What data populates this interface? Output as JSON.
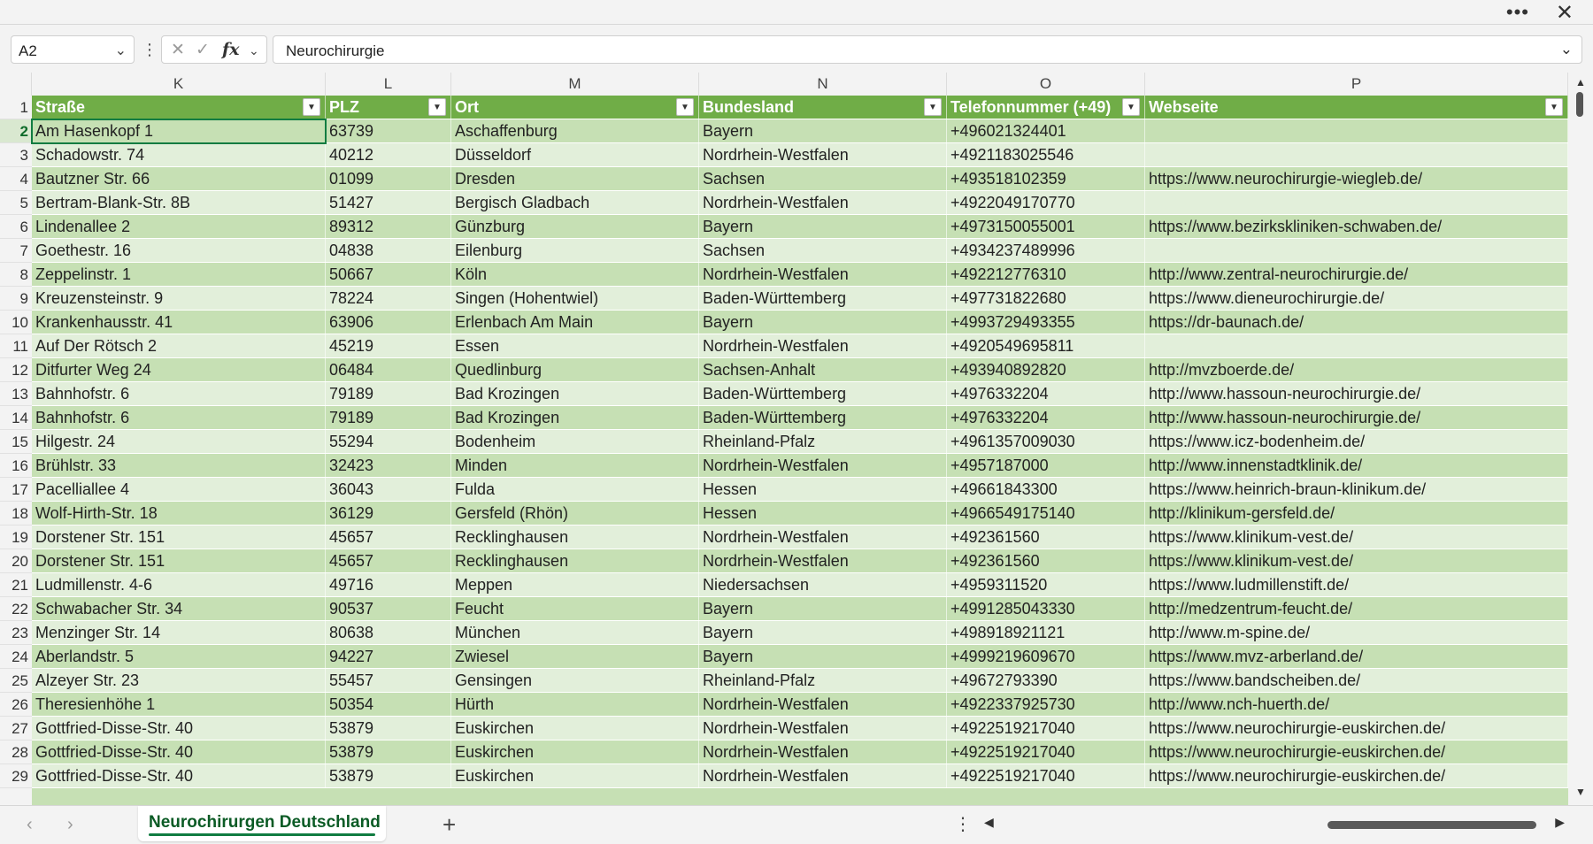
{
  "window": {
    "more_icon": "more-icon",
    "close_icon": "close-icon"
  },
  "formula_bar": {
    "name_box": "A2",
    "fx_label": "fx",
    "content": "Neurochirurgie"
  },
  "columns": [
    {
      "letter": "K",
      "header": "Straße"
    },
    {
      "letter": "L",
      "header": "PLZ"
    },
    {
      "letter": "M",
      "header": "Ort"
    },
    {
      "letter": "N",
      "header": "Bundesland"
    },
    {
      "letter": "O",
      "header": "Telefonnummer (+49)"
    },
    {
      "letter": "P",
      "header": "Webseite"
    }
  ],
  "header_row_number": "1",
  "rows": [
    {
      "n": "2",
      "cells": [
        "Am Hasenkopf 1",
        "63739",
        "Aschaffenburg",
        "Bayern",
        "+496021324401",
        ""
      ]
    },
    {
      "n": "3",
      "cells": [
        "Schadowstr. 74",
        "40212",
        "Düsseldorf",
        "Nordrhein-Westfalen",
        "+4921183025546",
        ""
      ]
    },
    {
      "n": "4",
      "cells": [
        "Bautzner Str. 66",
        "01099",
        "Dresden",
        "Sachsen",
        "+493518102359",
        "https://www.neurochirurgie-wiegleb.de/"
      ]
    },
    {
      "n": "5",
      "cells": [
        "Bertram-Blank-Str. 8B",
        "51427",
        "Bergisch Gladbach",
        "Nordrhein-Westfalen",
        "+4922049170770",
        ""
      ]
    },
    {
      "n": "6",
      "cells": [
        "Lindenallee 2",
        "89312",
        "Günzburg",
        "Bayern",
        "+4973150055001",
        "https://www.bezirkskliniken-schwaben.de/"
      ]
    },
    {
      "n": "7",
      "cells": [
        "Goethestr. 16",
        "04838",
        "Eilenburg",
        "Sachsen",
        "+4934237489996",
        ""
      ]
    },
    {
      "n": "8",
      "cells": [
        "Zeppelinstr. 1",
        "50667",
        "Köln",
        "Nordrhein-Westfalen",
        "+492212776310",
        "http://www.zentral-neurochirurgie.de/"
      ]
    },
    {
      "n": "9",
      "cells": [
        "Kreuzensteinstr. 9",
        "78224",
        "Singen (Hohentwiel)",
        "Baden-Württemberg",
        "+497731822680",
        "https://www.dieneurochirurgie.de/"
      ]
    },
    {
      "n": "10",
      "cells": [
        "Krankenhausstr. 41",
        "63906",
        "Erlenbach Am Main",
        "Bayern",
        "+4993729493355",
        "https://dr-baunach.de/"
      ]
    },
    {
      "n": "11",
      "cells": [
        "Auf Der Rötsch 2",
        "45219",
        "Essen",
        "Nordrhein-Westfalen",
        "+4920549695811",
        ""
      ]
    },
    {
      "n": "12",
      "cells": [
        "Ditfurter Weg 24",
        "06484",
        "Quedlinburg",
        "Sachsen-Anhalt",
        "+493940892820",
        "http://mvzboerde.de/"
      ]
    },
    {
      "n": "13",
      "cells": [
        "Bahnhofstr. 6",
        "79189",
        "Bad Krozingen",
        "Baden-Württemberg",
        "+4976332204",
        "http://www.hassoun-neurochirurgie.de/"
      ]
    },
    {
      "n": "14",
      "cells": [
        "Bahnhofstr. 6",
        "79189",
        "Bad Krozingen",
        "Baden-Württemberg",
        "+4976332204",
        "http://www.hassoun-neurochirurgie.de/"
      ]
    },
    {
      "n": "15",
      "cells": [
        "Hilgestr. 24",
        "55294",
        "Bodenheim",
        "Rheinland-Pfalz",
        "+4961357009030",
        "https://www.icz-bodenheim.de/"
      ]
    },
    {
      "n": "16",
      "cells": [
        "Brühlstr. 33",
        "32423",
        "Minden",
        "Nordrhein-Westfalen",
        "+4957187000",
        "http://www.innenstadtklinik.de/"
      ]
    },
    {
      "n": "17",
      "cells": [
        "Pacelliallee 4",
        "36043",
        "Fulda",
        "Hessen",
        "+49661843300",
        "https://www.heinrich-braun-klinikum.de/"
      ]
    },
    {
      "n": "18",
      "cells": [
        "Wolf-Hirth-Str. 18",
        "36129",
        "Gersfeld (Rhön)",
        "Hessen",
        "+4966549175140",
        "http://klinikum-gersfeld.de/"
      ]
    },
    {
      "n": "19",
      "cells": [
        "Dorstener Str. 151",
        "45657",
        "Recklinghausen",
        "Nordrhein-Westfalen",
        "+492361560",
        "https://www.klinikum-vest.de/"
      ]
    },
    {
      "n": "20",
      "cells": [
        "Dorstener Str. 151",
        "45657",
        "Recklinghausen",
        "Nordrhein-Westfalen",
        "+492361560",
        "https://www.klinikum-vest.de/"
      ]
    },
    {
      "n": "21",
      "cells": [
        "Ludmillenstr. 4-6",
        "49716",
        "Meppen",
        "Niedersachsen",
        "+4959311520",
        "https://www.ludmillenstift.de/"
      ]
    },
    {
      "n": "22",
      "cells": [
        "Schwabacher Str. 34",
        "90537",
        "Feucht",
        "Bayern",
        "+4991285043330",
        "http://medzentrum-feucht.de/"
      ]
    },
    {
      "n": "23",
      "cells": [
        "Menzinger Str. 14",
        "80638",
        "München",
        "Bayern",
        "+498918921121",
        "http://www.m-spine.de/"
      ]
    },
    {
      "n": "24",
      "cells": [
        "Aberlandstr. 5",
        "94227",
        "Zwiesel",
        "Bayern",
        "+4999219609670",
        "https://www.mvz-arberland.de/"
      ]
    },
    {
      "n": "25",
      "cells": [
        "Alzeyer Str. 23",
        "55457",
        "Gensingen",
        "Rheinland-Pfalz",
        "+49672793390",
        "https://www.bandscheiben.de/"
      ]
    },
    {
      "n": "26",
      "cells": [
        "Theresienhöhe 1",
        "50354",
        "Hürth",
        "Nordrhein-Westfalen",
        "+4922337925730",
        "http://www.nch-huerth.de/"
      ]
    },
    {
      "n": "27",
      "cells": [
        "Gottfried-Disse-Str. 40",
        "53879",
        "Euskirchen",
        "Nordrhein-Westfalen",
        "+4922519217040",
        "https://www.neurochirurgie-euskirchen.de/"
      ]
    },
    {
      "n": "28",
      "cells": [
        "Gottfried-Disse-Str. 40",
        "53879",
        "Euskirchen",
        "Nordrhein-Westfalen",
        "+4922519217040",
        "https://www.neurochirurgie-euskirchen.de/"
      ]
    },
    {
      "n": "29",
      "cells": [
        "Gottfried-Disse-Str. 40",
        "53879",
        "Euskirchen",
        "Nordrhein-Westfalen",
        "+4922519217040",
        "https://www.neurochirurgie-euskirchen.de/"
      ]
    }
  ],
  "sheet_tabs": [
    {
      "label": "Neurochirurgen Deutschland",
      "active": true
    }
  ],
  "colors": {
    "header_fill": "#70ad47",
    "band_dark": "#c6e0b4",
    "band_light": "#e2efda",
    "accent": "#107c41"
  }
}
